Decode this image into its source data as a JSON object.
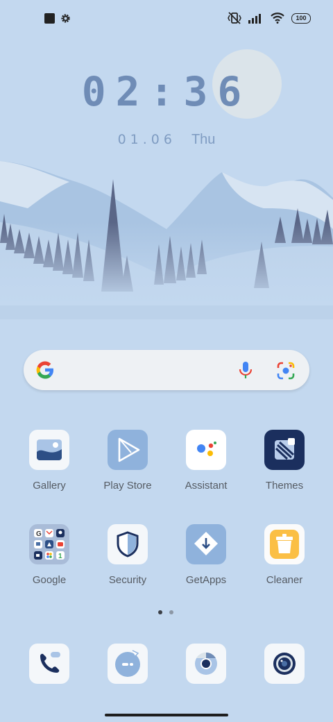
{
  "status_bar": {
    "battery": "100",
    "left_icons": [
      "stop-square-icon",
      "gear-icon"
    ],
    "right_icons": [
      "vibrate-icon",
      "signal-icon",
      "wifi-icon",
      "battery-icon"
    ]
  },
  "clock": {
    "time": "02:36",
    "date": "01.06",
    "day": "Thu"
  },
  "search": {
    "icons": [
      "google-g-icon",
      "mic-icon",
      "google-lens-icon"
    ]
  },
  "apps_row1": [
    {
      "label": "Gallery",
      "icon": "gallery-icon"
    },
    {
      "label": "Play Store",
      "icon": "play-store-icon"
    },
    {
      "label": "Assistant",
      "icon": "assistant-icon"
    },
    {
      "label": "Themes",
      "icon": "themes-icon"
    }
  ],
  "apps_row2": [
    {
      "label": "Google",
      "icon": "google-folder-icon"
    },
    {
      "label": "Security",
      "icon": "shield-icon"
    },
    {
      "label": "GetApps",
      "icon": "getapps-icon"
    },
    {
      "label": "Cleaner",
      "icon": "trash-bin-icon"
    }
  ],
  "page_indicator": {
    "count": 2,
    "active": 0
  },
  "dock": [
    "phone-icon",
    "messaging-icon",
    "chrome-icon",
    "camera-icon"
  ],
  "colors": {
    "clock": "#6f8cb6",
    "label": "#555b63",
    "wallpaper": "#c3d8ef"
  }
}
